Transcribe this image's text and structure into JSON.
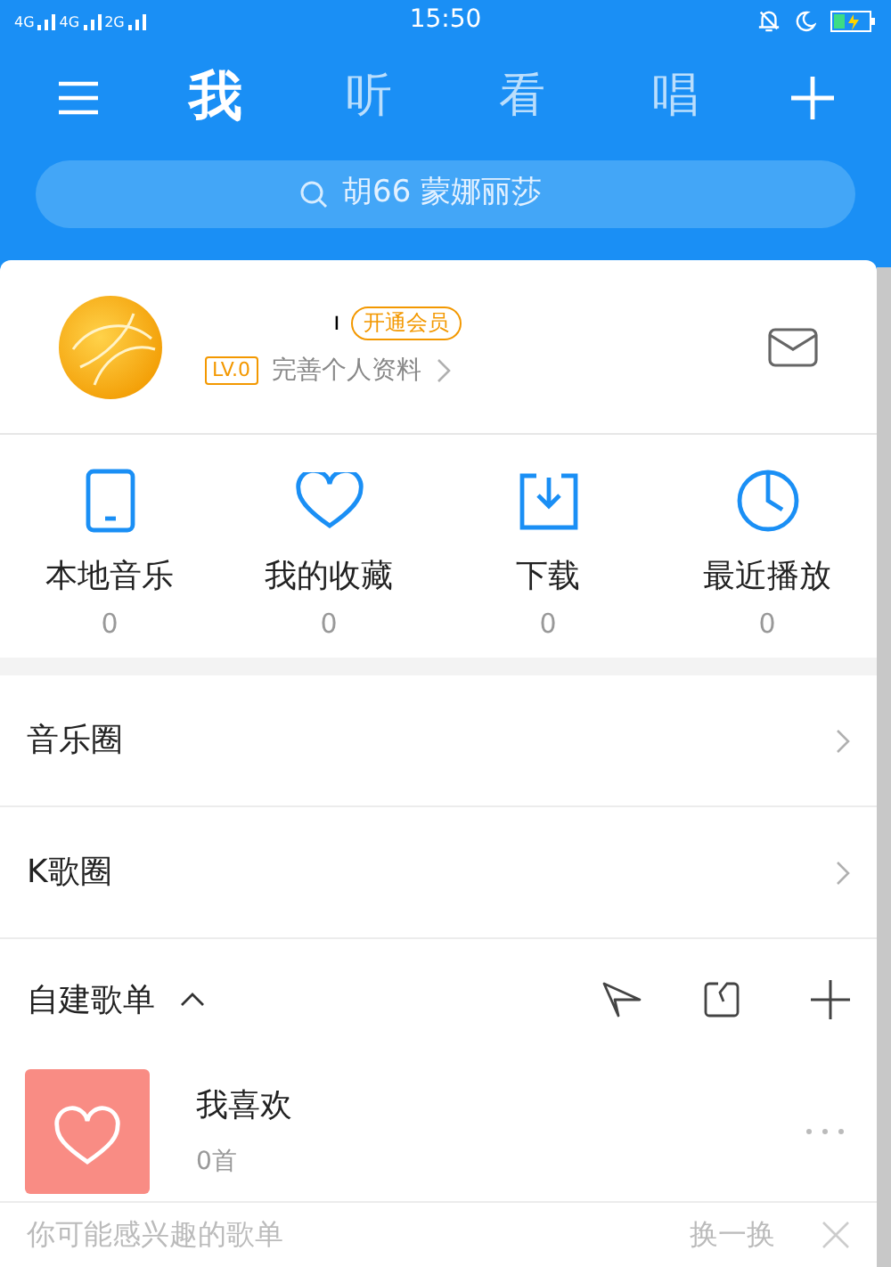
{
  "status_bar": {
    "networks": [
      "4G",
      "4G",
      "2G"
    ],
    "time": "15:50"
  },
  "tabs": [
    {
      "label": "我",
      "selected": true
    },
    {
      "label": "听",
      "selected": false
    },
    {
      "label": "看",
      "selected": false
    },
    {
      "label": "唱",
      "selected": false
    }
  ],
  "search": {
    "placeholder": "胡66 蒙娜丽莎"
  },
  "profile": {
    "username": "ı",
    "vip_badge": "开通会员",
    "level": "LV.0",
    "complete_link": "完善个人资料"
  },
  "shortcuts": [
    {
      "kind": "phone",
      "label": "本地音乐",
      "count": "0"
    },
    {
      "kind": "heart",
      "label": "我的收藏",
      "count": "0"
    },
    {
      "kind": "download",
      "label": "下载",
      "count": "0"
    },
    {
      "kind": "clock",
      "label": "最近播放",
      "count": "0"
    }
  ],
  "menu_items": [
    "音乐圈",
    "K歌圈"
  ],
  "playlists_section": {
    "title": "自建歌单",
    "expanded": true,
    "playlists": [
      {
        "name": "我喜欢",
        "count": "0首"
      }
    ]
  },
  "recommend_bar": {
    "title": "你可能感兴趣的歌单",
    "refresh": "换一换"
  }
}
